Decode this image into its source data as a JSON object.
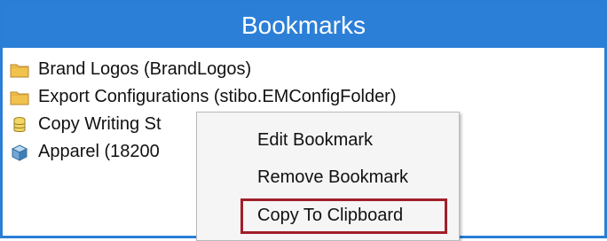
{
  "header": {
    "title": "Bookmarks"
  },
  "bookmarks": [
    {
      "label": "Brand Logos (BrandLogos)",
      "icon": "folder-icon"
    },
    {
      "label": "Export Configurations (stibo.EMConfigFolder)",
      "icon": "folder-icon"
    },
    {
      "label": "Copy Writing St",
      "icon": "database-icon"
    },
    {
      "label": "Apparel (18200",
      "icon": "cube-icon"
    }
  ],
  "context_menu": {
    "items": [
      {
        "label": "Edit Bookmark"
      },
      {
        "label": "Remove Bookmark"
      },
      {
        "label": "Copy To Clipboard"
      }
    ]
  },
  "colors": {
    "header_bg": "#2b7fd7",
    "highlight_border": "#a11f2a"
  }
}
